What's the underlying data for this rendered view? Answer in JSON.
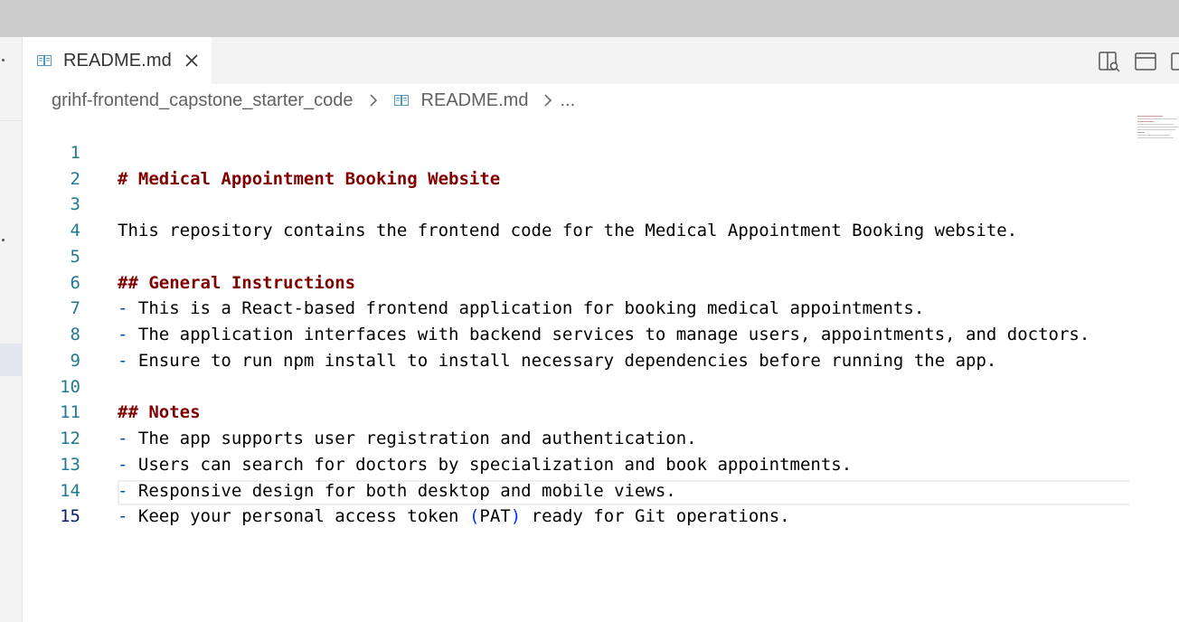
{
  "tab": {
    "label": "README.md",
    "icon": "book-icon"
  },
  "breadcrumb": {
    "folder": "grihf-frontend_capstone_starter_code",
    "file": "README.md",
    "more": "..."
  },
  "editor": {
    "active_line": 15,
    "lines": [
      {
        "n": "1",
        "text": "# Medical Appointment Booking Website"
      },
      {
        "n": "2",
        "text": ""
      },
      {
        "n": "3",
        "text": "This repository contains the frontend code for the Medical Appointment Booking website."
      },
      {
        "n": "4",
        "text": ""
      },
      {
        "n": "5",
        "text": "## General Instructions"
      },
      {
        "n": "6",
        "bullet": "-",
        "text": " This is a React-based frontend application for booking medical appointments."
      },
      {
        "n": "7",
        "bullet": "-",
        "text": " The application interfaces with backend services to manage users, appointments, and doctors."
      },
      {
        "n": "8",
        "bullet": "-",
        "text": " Ensure to run npm install to install necessary dependencies before running the app."
      },
      {
        "n": "9",
        "text": ""
      },
      {
        "n": "10",
        "text": "## Notes"
      },
      {
        "n": "11",
        "bullet": "-",
        "text": " The app supports user registration and authentication."
      },
      {
        "n": "12",
        "bullet": "-",
        "text": " Users can search for doctors by specialization and book appointments."
      },
      {
        "n": "13",
        "bullet": "-",
        "text": " Responsive design for both desktop and mobile views."
      },
      {
        "n": "14",
        "bullet": "-",
        "text_before": " Keep your personal access token ",
        "paren_open": "(",
        "paren_text": "PAT",
        "paren_close": ")",
        "text_after": " ready for Git operations."
      },
      {
        "n": "15",
        "text": ""
      }
    ]
  },
  "colors": {
    "heading": "#800000",
    "bullet": "#0451a5",
    "line_number": "#237893",
    "active_line_number": "#0b216f",
    "bracket": "#0431fa"
  },
  "icons": {
    "tab_close": "close-icon",
    "breadcrumb_separator": "chevron-right-icon",
    "actions": [
      "open-preview-to-side-icon",
      "toggle-panel-icon",
      "more-actions-icon"
    ]
  }
}
